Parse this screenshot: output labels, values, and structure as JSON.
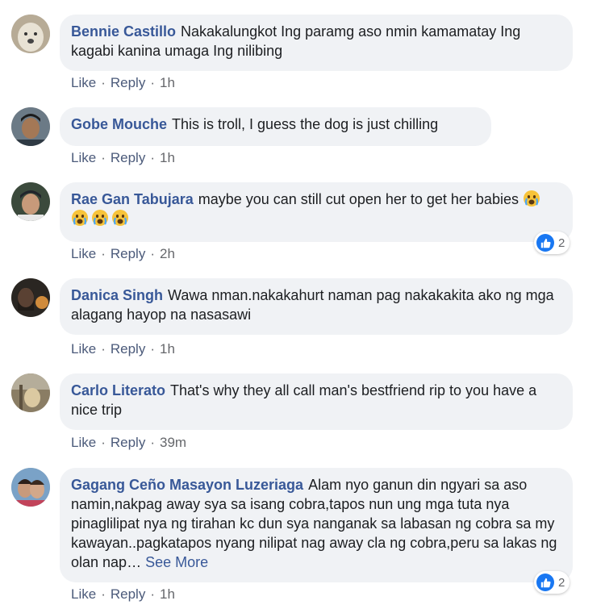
{
  "comments": [
    {
      "author": "Bennie Castillo",
      "text": "Nakakalungkot Ing paramg aso nmin kamamatay Ing kagabi kanina umaga Ing nilibing",
      "like": "Like",
      "reply": "Reply",
      "time": "1h"
    },
    {
      "author": "Gobe Mouche",
      "text": "This is troll, I guess the dog is just chilling",
      "like": "Like",
      "reply": "Reply",
      "time": "1h"
    },
    {
      "author": "Rae Gan Tabujara",
      "text": "maybe you can still cut open her to get her babies",
      "emoji": [
        "crying-face-emoji",
        "crying-face-emoji",
        "crying-face-emoji",
        "crying-face-emoji"
      ],
      "like": "Like",
      "reply": "Reply",
      "time": "2h",
      "reaction_count": "2"
    },
    {
      "author": "Danica Singh",
      "text": "Wawa nman.nakakahurt naman pag nakakakita ako ng mga alagang hayop na nasasawi",
      "like": "Like",
      "reply": "Reply",
      "time": "1h"
    },
    {
      "author": "Carlo Literato",
      "text": "That's why they all call man's bestfriend rip to you have a nice trip",
      "like": "Like",
      "reply": "Reply",
      "time": "39m"
    },
    {
      "author": "Gagang Ceño Masayon Luzeriaga",
      "text": "Alam nyo ganun din ngyari sa aso namin,nakpag away sya sa isang cobra,tapos nun ung mga tuta nya pinaglilipat nya ng tirahan kc dun sya nanganak sa labasan ng cobra sa my kawayan..pagkatapos nyang nilipat nag away cla ng cobra,peru sa lakas ng olan nap…",
      "see_more": "See More",
      "like": "Like",
      "reply": "Reply",
      "time": "1h",
      "reaction_count": "2"
    }
  ],
  "colors": {
    "name": "#385898",
    "bubble": "#f0f2f5",
    "like_blue": "#1877f2",
    "meta": "#65676b"
  }
}
